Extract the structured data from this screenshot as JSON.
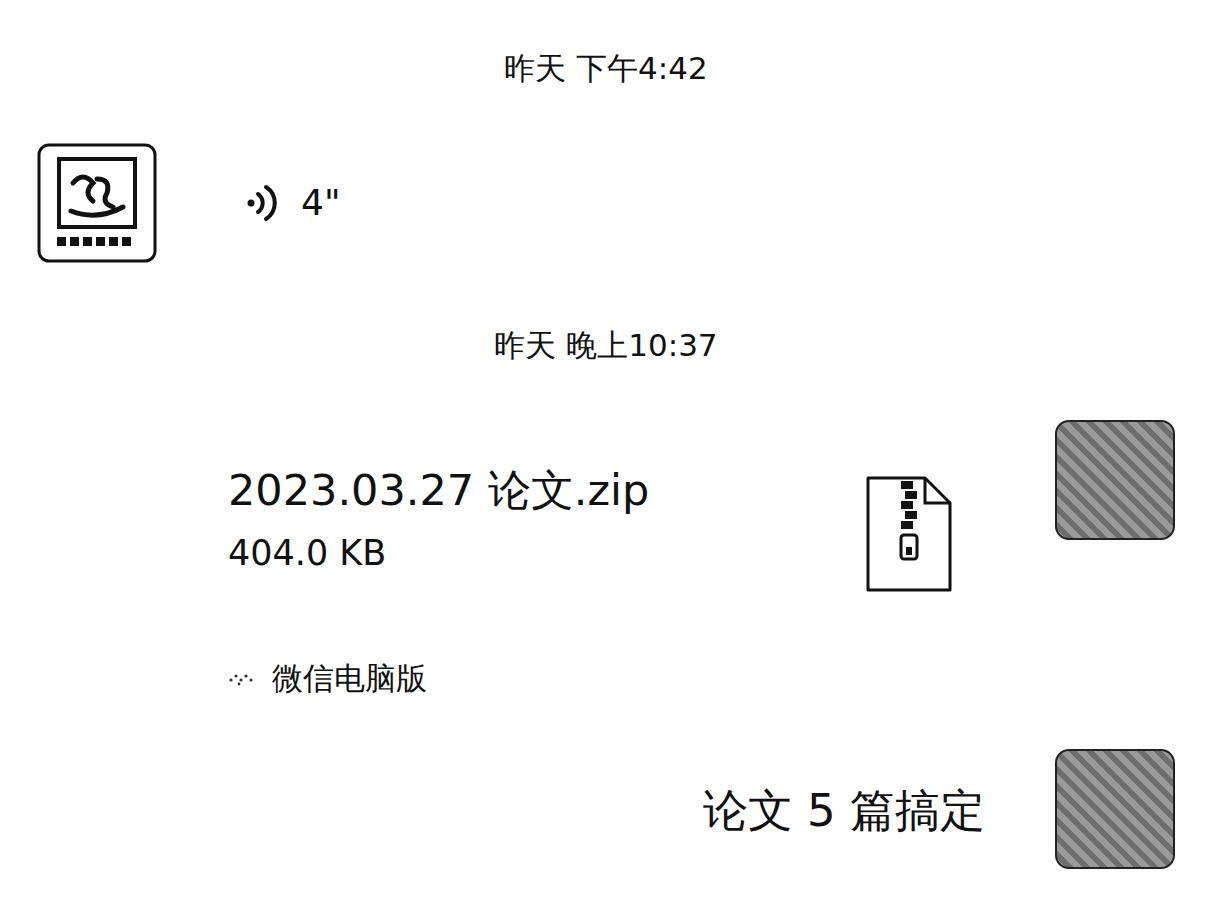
{
  "messages": [
    {
      "kind": "time",
      "text": "昨天 下午4:42"
    },
    {
      "kind": "voice",
      "outgoing": false,
      "duration": "4\""
    },
    {
      "kind": "time",
      "text": "昨天 晚上10:37"
    },
    {
      "kind": "file",
      "outgoing": true,
      "name": "2023.03.27 论文.zip",
      "size": "404.0 KB",
      "source": "微信电脑版"
    },
    {
      "kind": "text",
      "outgoing": true,
      "text": "论文 5 篇搞定"
    }
  ]
}
